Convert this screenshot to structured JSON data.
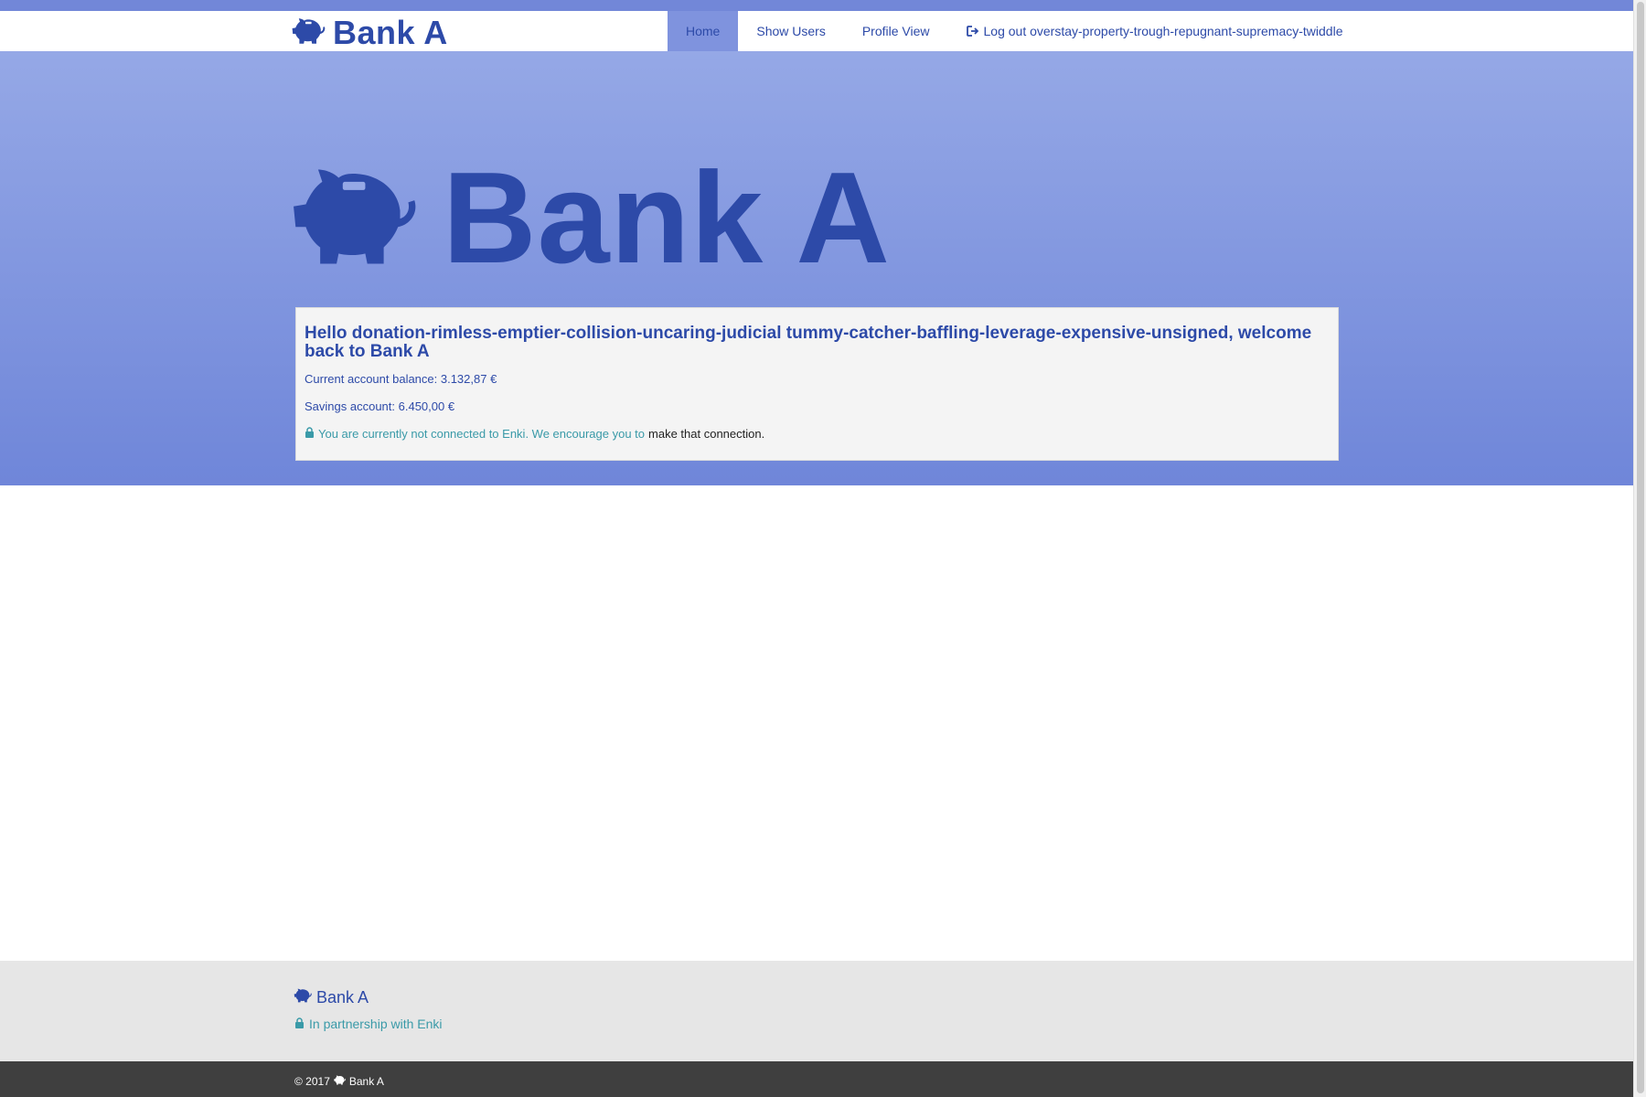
{
  "colors": {
    "brand_blue": "#2d4aa8",
    "hero_gradient_top": "#95a8e6",
    "hero_gradient_bottom": "#6f86d9",
    "enki_teal": "#3a9aa8",
    "footer_bg": "#e6e6e6",
    "bottom_bar_bg": "#3f3f3f"
  },
  "navbar": {
    "brand": "Bank A",
    "brand_icon": "piggy-bank-icon",
    "items": [
      {
        "label": "Home",
        "active": true
      },
      {
        "label": "Show Users",
        "active": false
      },
      {
        "label": "Profile View",
        "active": false
      },
      {
        "label": "Log out overstay-property-trough-repugnant-supremacy-twiddle",
        "icon": "logout-icon",
        "active": false
      }
    ]
  },
  "hero": {
    "brand": "Bank A",
    "brand_icon": "piggy-bank-icon"
  },
  "welcome": {
    "title": "Hello donation-rimless-emptier-collision-uncaring-judicial tummy-catcher-baffling-leverage-expensive-unsigned, welcome back to Bank A",
    "current_balance": "Current account balance: 3.132,87 €",
    "savings": "Savings account: 6.450,00 €",
    "enki_icon": "lock-icon",
    "enki_text": "You are currently not connected to Enki. We encourage you to",
    "enki_link": "make that connection",
    "enki_end": "."
  },
  "footer": {
    "brand": "Bank A",
    "brand_icon": "piggy-bank-icon",
    "partner_icon": "lock-icon",
    "partner_text": "In partnership with Enki"
  },
  "bottom_bar": {
    "copyright_prefix": "© 2017",
    "brand": "Bank A"
  }
}
